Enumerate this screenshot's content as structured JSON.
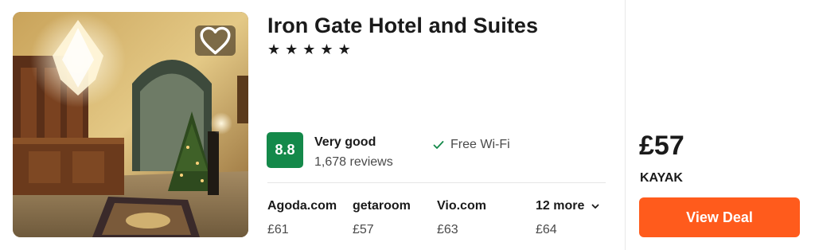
{
  "hotel": {
    "name": "Iron Gate Hotel and Suites",
    "stars": 5,
    "star_glyph": "★",
    "score": "8.8",
    "rating_label": "Very good",
    "reviews": "1,678 reviews",
    "amenity": "Free Wi-Fi"
  },
  "providers": [
    {
      "name": "Agoda.com",
      "price": "£61"
    },
    {
      "name": "getaroom",
      "price": "£57"
    },
    {
      "name": "Vio.com",
      "price": "£63"
    },
    {
      "name": "12 more",
      "price": "£64"
    }
  ],
  "best_deal": {
    "price": "£57",
    "provider": "KAYAK",
    "button_label": "View Deal"
  },
  "icons": {
    "favorite": "heart-icon",
    "amenity_check": "check-icon",
    "more_chevron": "chevron-down-icon"
  },
  "colors": {
    "score_badge": "#14894a",
    "deal_button": "#ff5b1c"
  }
}
